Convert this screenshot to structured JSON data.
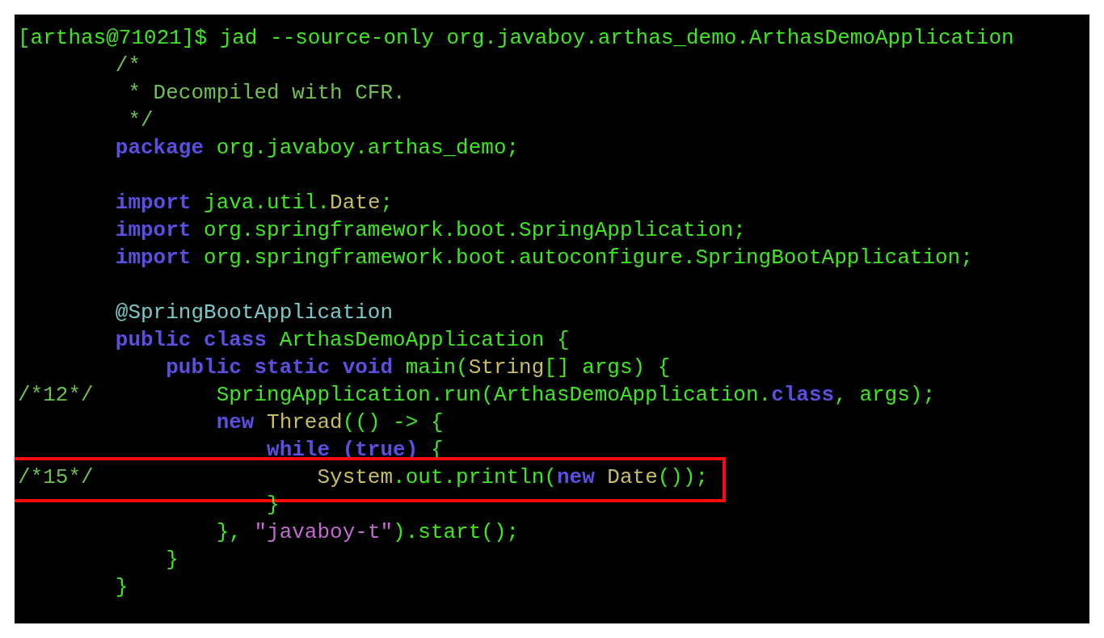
{
  "terminal": {
    "lines": [
      {
        "kind": "prompt",
        "segments": [
          {
            "text": "[arthas@71021]$ jad --source-only org.javaboy.arthas_demo.ArthasDemoApplication",
            "kind": "plain"
          }
        ]
      },
      {
        "kind": "code",
        "segments": [
          {
            "text": "/*",
            "kind": "comment"
          }
        ]
      },
      {
        "kind": "code",
        "segments": [
          {
            "text": " * Decompiled with CFR.",
            "kind": "comment"
          }
        ]
      },
      {
        "kind": "code",
        "segments": [
          {
            "text": " */",
            "kind": "comment"
          }
        ]
      },
      {
        "kind": "code",
        "segments": [
          {
            "text": "package",
            "kind": "keyword"
          },
          {
            "text": " org.javaboy.arthas_demo;",
            "kind": "plain"
          }
        ]
      },
      {
        "kind": "blank"
      },
      {
        "kind": "code",
        "segments": [
          {
            "text": "import",
            "kind": "keyword"
          },
          {
            "text": " java.util.",
            "kind": "plain"
          },
          {
            "text": "Date",
            "kind": "type"
          },
          {
            "text": ";",
            "kind": "plain"
          }
        ]
      },
      {
        "kind": "code",
        "segments": [
          {
            "text": "import",
            "kind": "keyword"
          },
          {
            "text": " org.springframework.boot.SpringApplication;",
            "kind": "plain"
          }
        ]
      },
      {
        "kind": "code",
        "segments": [
          {
            "text": "import",
            "kind": "keyword"
          },
          {
            "text": " org.springframework.boot.autoconfigure.SpringBootApplication;",
            "kind": "plain"
          }
        ]
      },
      {
        "kind": "blank"
      },
      {
        "kind": "code",
        "segments": [
          {
            "text": "@SpringBootApplication",
            "kind": "annotation"
          }
        ]
      },
      {
        "kind": "code",
        "segments": [
          {
            "text": "public class",
            "kind": "keyword"
          },
          {
            "text": " ArthasDemoApplication {",
            "kind": "plain"
          }
        ]
      },
      {
        "kind": "code",
        "segments": [
          {
            "text": "    public static void",
            "kind": "keyword"
          },
          {
            "text": " main(",
            "kind": "plain"
          },
          {
            "text": "String",
            "kind": "type"
          },
          {
            "text": "[] args) {",
            "kind": "plain"
          }
        ]
      },
      {
        "kind": "code",
        "gutter": "/*12*/",
        "segments": [
          {
            "text": "        SpringApplication.run(ArthasDemoApplication.",
            "kind": "plain"
          },
          {
            "text": "class",
            "kind": "keyword"
          },
          {
            "text": ", args);",
            "kind": "plain"
          }
        ]
      },
      {
        "kind": "code",
        "segments": [
          {
            "text": "        new",
            "kind": "keyword"
          },
          {
            "text": " Thread",
            "kind": "type"
          },
          {
            "text": "(() -> {",
            "kind": "plain"
          }
        ]
      },
      {
        "kind": "code",
        "segments": [
          {
            "text": "            while (true)",
            "kind": "keyword"
          },
          {
            "text": " {",
            "kind": "plain"
          }
        ]
      },
      {
        "kind": "code",
        "gutter": "/*15*/",
        "highlighted": true,
        "segments": [
          {
            "text": "                System",
            "kind": "type"
          },
          {
            "text": ".out.println(",
            "kind": "plain"
          },
          {
            "text": "new",
            "kind": "keyword"
          },
          {
            "text": " Date",
            "kind": "type"
          },
          {
            "text": "());",
            "kind": "plain"
          }
        ]
      },
      {
        "kind": "code",
        "segments": [
          {
            "text": "            }",
            "kind": "plain"
          }
        ]
      },
      {
        "kind": "code",
        "segments": [
          {
            "text": "        }, ",
            "kind": "plain"
          },
          {
            "text": "\"javaboy-t\"",
            "kind": "string"
          },
          {
            "text": ").start();",
            "kind": "plain"
          }
        ]
      },
      {
        "kind": "code",
        "segments": [
          {
            "text": "    }",
            "kind": "plain"
          }
        ]
      },
      {
        "kind": "code",
        "segments": [
          {
            "text": "}",
            "kind": "plain"
          }
        ]
      }
    ]
  }
}
